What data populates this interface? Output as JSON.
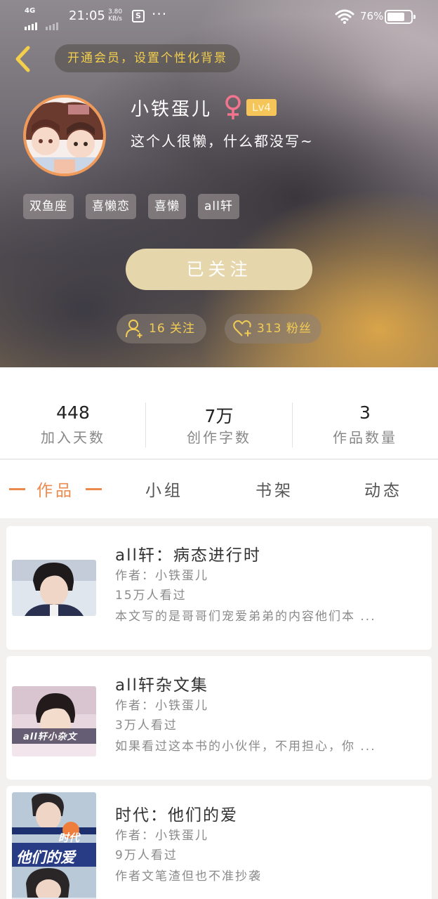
{
  "status_bar": {
    "network": "4G",
    "time": "21:05",
    "speed_value": "3.80",
    "speed_unit": "KB/s",
    "more": "···",
    "battery_percent": "76%",
    "battery_level": 0.76
  },
  "header": {
    "vip_prompt": "开通会员，设置个性化背景"
  },
  "profile": {
    "nickname": "小铁蛋儿",
    "level": "Lv4",
    "bio": "这个人很懒，什么都没写~",
    "tags": [
      "双鱼座",
      "喜懒恋",
      "喜懒",
      "all轩"
    ],
    "follow_button": "已关注",
    "following_text": "16 关注",
    "fans_text": "313 粉丝"
  },
  "stats": [
    {
      "value": "448",
      "label": "加入天数"
    },
    {
      "value": "7万",
      "label": "创作字数"
    },
    {
      "value": "3",
      "label": "作品数量"
    }
  ],
  "tabs": [
    {
      "label": "作品",
      "active": true
    },
    {
      "label": "小组",
      "active": false
    },
    {
      "label": "书架",
      "active": false
    },
    {
      "label": "动态",
      "active": false
    }
  ],
  "works": [
    {
      "title": "all轩：病态进行时",
      "author": "作者：小铁蛋儿",
      "views": "15万人看过",
      "summary": "本文写的是哥哥们宠爱弟弟的内容他们本 ..."
    },
    {
      "title": "all轩杂文集",
      "author": "作者：小铁蛋儿",
      "views": "3万人看过",
      "summary": "如果看过这本书的小伙伴，不用担心，你 ...",
      "cover_text": "all轩小杂文"
    },
    {
      "title": "时代：他们的爱",
      "author": "作者：小铁蛋儿",
      "views": "9万人看过",
      "summary": "作者文笔渣但也不准抄袭",
      "cover_text_top": "时代",
      "cover_text_bottom": "他们的爱"
    }
  ],
  "colors": {
    "accent": "#ec8a4d",
    "gold": "#f2cc55",
    "follow_button": "#e5d6ac",
    "level_badge": "#f6c55a",
    "gender": "#f2748d"
  }
}
